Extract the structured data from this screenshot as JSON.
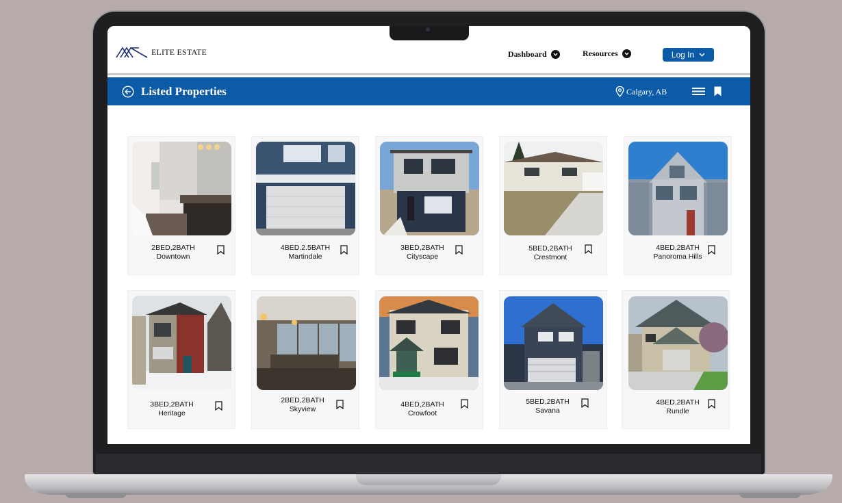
{
  "brand": {
    "name": "ELITE ESTATE"
  },
  "nav": {
    "dashboard": "Dashboard",
    "resources": "Resources",
    "login": "Log In"
  },
  "header": {
    "title": "Listed Properties",
    "location": "Calgary, AB"
  },
  "colors": {
    "primary": "#0c5ba6",
    "card_bg": "#f7f7f9"
  },
  "listings": [
    {
      "beds": "2BED,2BATH",
      "area": "Downtown",
      "photo": "bathroom"
    },
    {
      "beds": "4BED.2.5BATH",
      "area": "Martindale",
      "photo": "garage-house"
    },
    {
      "beds": "3BED,2BATH",
      "area": "Cityscape",
      "photo": "two-storey-house"
    },
    {
      "beds": "5BED,2BATH",
      "area": "Crestmont",
      "photo": "split-level-house"
    },
    {
      "beds": "4BED,2BATH",
      "area": "Panoroma Hills",
      "photo": "townhouse"
    },
    {
      "beds": "3BED,2BATH",
      "area": "Heritage",
      "photo": "modern-house"
    },
    {
      "beds": "2BED,2BATH",
      "area": "Skyview",
      "photo": "condo-interior"
    },
    {
      "beds": "4BED,2BATH",
      "area": "Crowfoot",
      "photo": "sunset-house"
    },
    {
      "beds": "5BED,2BATH",
      "area": "Savana",
      "photo": "navy-house"
    },
    {
      "beds": "4BED,2BATH",
      "area": "Rundle",
      "photo": "beige-house"
    }
  ]
}
